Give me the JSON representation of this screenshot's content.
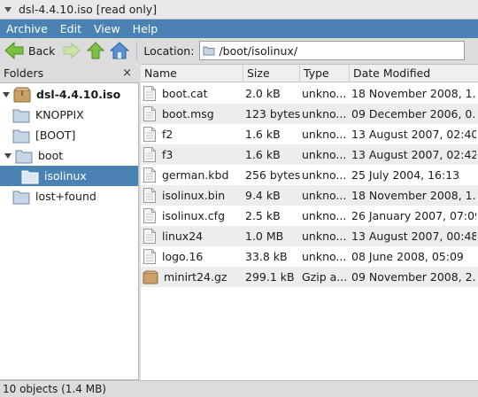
{
  "window": {
    "title": "dsl-4.4.10.iso [read only]"
  },
  "menu": [
    "Archive",
    "Edit",
    "View",
    "Help"
  ],
  "toolbar": {
    "back_label": "Back",
    "location_label": "Location:",
    "location_value": "/boot/isolinux/"
  },
  "folders": {
    "header": "Folders",
    "close": "×",
    "items": [
      {
        "label": "dsl-4.4.10.iso",
        "icon": "archive-icon",
        "expanded": true,
        "selected": false
      },
      {
        "label": "KNOPPIX",
        "icon": "folder-icon",
        "selected": false
      },
      {
        "label": "[BOOT]",
        "icon": "folder-icon",
        "selected": false
      },
      {
        "label": "boot",
        "icon": "folder-icon",
        "expanded": true,
        "selected": false
      },
      {
        "label": "isolinux",
        "icon": "folder-open-icon",
        "selected": true
      },
      {
        "label": "lost+found",
        "icon": "folder-icon",
        "selected": false
      }
    ]
  },
  "columns": [
    "Name",
    "Size",
    "Type",
    "Date Modified"
  ],
  "files": [
    {
      "name": "boot.cat",
      "size": "2.0 kB",
      "type": "unkno...",
      "date": "18 November 2008, 1...",
      "icon": "file-icon"
    },
    {
      "name": "boot.msg",
      "size": "123 bytes",
      "type": "unkno...",
      "date": "09 December 2006, 0...",
      "icon": "file-icon"
    },
    {
      "name": "f2",
      "size": "1.6 kB",
      "type": "unkno...",
      "date": "13 August 2007, 02:40",
      "icon": "file-icon"
    },
    {
      "name": "f3",
      "size": "1.6 kB",
      "type": "unkno...",
      "date": "13 August 2007, 02:42",
      "icon": "file-icon"
    },
    {
      "name": "german.kbd",
      "size": "256 bytes",
      "type": "unkno...",
      "date": "25 July 2004, 16:13",
      "icon": "file-icon"
    },
    {
      "name": "isolinux.bin",
      "size": "9.4 kB",
      "type": "unkno...",
      "date": "18 November 2008, 1...",
      "icon": "file-icon"
    },
    {
      "name": "isolinux.cfg",
      "size": "2.5 kB",
      "type": "unkno...",
      "date": "26 January 2007, 07:09",
      "icon": "file-icon"
    },
    {
      "name": "linux24",
      "size": "1.0 MB",
      "type": "unkno...",
      "date": "13 August 2007, 00:48",
      "icon": "file-icon"
    },
    {
      "name": "logo.16",
      "size": "33.8 kB",
      "type": "unkno...",
      "date": "08 June 2008, 05:09",
      "icon": "file-icon"
    },
    {
      "name": "minirt24.gz",
      "size": "299.1 kB",
      "type": "Gzip a...",
      "date": "09 November 2008, 2...",
      "icon": "archive-icon"
    }
  ],
  "status": "10 objects (1.4 MB)",
  "colors": {
    "accent": "#4a82b4",
    "arrow_green": "#7cc142"
  }
}
